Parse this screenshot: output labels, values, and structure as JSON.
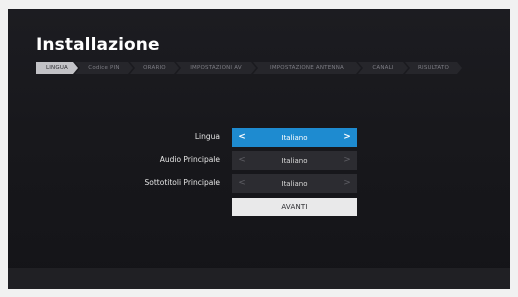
{
  "page": {
    "title": "Installazione"
  },
  "steps": [
    {
      "label": "LINGUA",
      "active": true
    },
    {
      "label": "Codice PIN",
      "active": false
    },
    {
      "label": "ORARIO",
      "active": false
    },
    {
      "label": "IMPOSTAZIONI AV",
      "active": false
    },
    {
      "label": "IMPOSTAZIONE ANTENNA",
      "active": false
    },
    {
      "label": "CANALI",
      "active": false
    },
    {
      "label": "RISULTATO",
      "active": false
    }
  ],
  "form": {
    "lingua": {
      "label": "Lingua",
      "value": "Italiano",
      "focused": true
    },
    "audio": {
      "label": "Audio Principale",
      "value": "Italiano",
      "focused": false
    },
    "sottotitoli": {
      "label": "Sottotitoli Principale",
      "value": "Italiano",
      "focused": false
    },
    "prev_arrow": "<",
    "next_arrow": ">"
  },
  "buttons": {
    "avanti_label": "AVANTI"
  },
  "colors": {
    "accent": "#1e8bd0",
    "background": "#18181c"
  }
}
